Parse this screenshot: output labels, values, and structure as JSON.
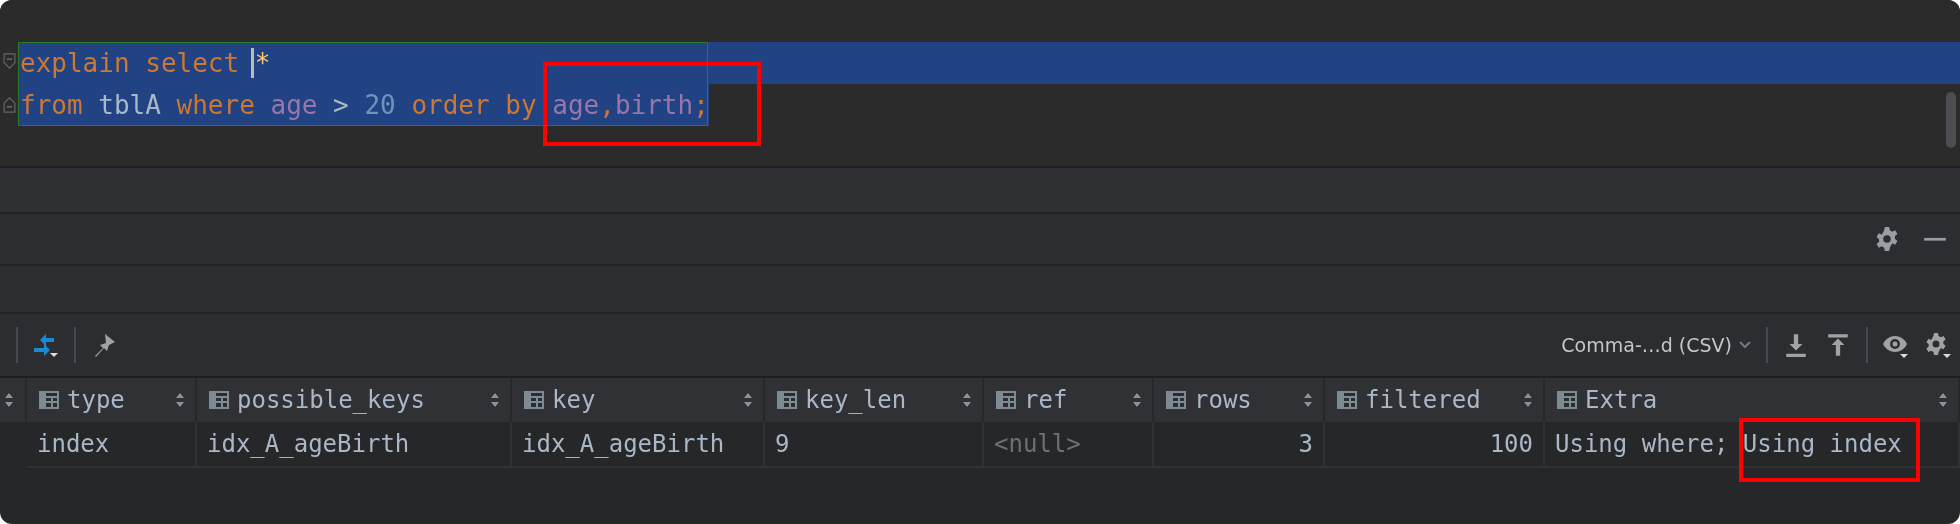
{
  "editor": {
    "lines": [
      {
        "selected": true,
        "tokens": [
          {
            "kind": "keyword",
            "text": "explain select "
          },
          {
            "kind": "star",
            "text": "*",
            "caret_before": true
          }
        ]
      },
      {
        "selected": true,
        "tokens": [
          {
            "kind": "keyword",
            "text": "from"
          },
          {
            "kind": "ident",
            "text": " tblA"
          },
          {
            "kind": "keyword",
            "text": " where"
          },
          {
            "kind": "column",
            "text": " age"
          },
          {
            "kind": "ident",
            "text": " >"
          },
          {
            "kind": "number",
            "text": " 20"
          },
          {
            "kind": "keyword",
            "text": " order"
          },
          {
            "kind": "keyword",
            "text": " by"
          },
          {
            "kind": "column",
            "text": " age",
            "boxed": true
          },
          {
            "kind": "keyword",
            "text": ",",
            "boxed": true
          },
          {
            "kind": "column",
            "text": "birth",
            "boxed": true
          },
          {
            "kind": "keyword",
            "text": ";",
            "boxed": true
          }
        ]
      }
    ]
  },
  "results": {
    "format": "Comma-…d (CSV)",
    "columns": [
      {
        "name": "type"
      },
      {
        "name": "possible_keys"
      },
      {
        "name": "key"
      },
      {
        "name": "key_len"
      },
      {
        "name": "ref"
      },
      {
        "name": "rows"
      },
      {
        "name": "filtered"
      },
      {
        "name": "Extra"
      }
    ],
    "rows": [
      {
        "cells": [
          {
            "kind": "text",
            "parts": [
              {
                "text": "index"
              }
            ]
          },
          {
            "kind": "text",
            "parts": [
              {
                "text": "idx_A_ageBirth"
              }
            ]
          },
          {
            "kind": "text",
            "parts": [
              {
                "text": "idx_A_ageBirth"
              }
            ]
          },
          {
            "kind": "text",
            "parts": [
              {
                "text": "9"
              }
            ]
          },
          {
            "kind": "null",
            "parts": [
              {
                "text": "<null>"
              }
            ]
          },
          {
            "kind": "number",
            "parts": [
              {
                "text": "3"
              }
            ]
          },
          {
            "kind": "number",
            "parts": [
              {
                "text": "100"
              }
            ]
          },
          {
            "kind": "text",
            "parts": [
              {
                "text": "Using where; "
              },
              {
                "text": "Using index",
                "boxed": true
              }
            ]
          }
        ]
      }
    ]
  }
}
